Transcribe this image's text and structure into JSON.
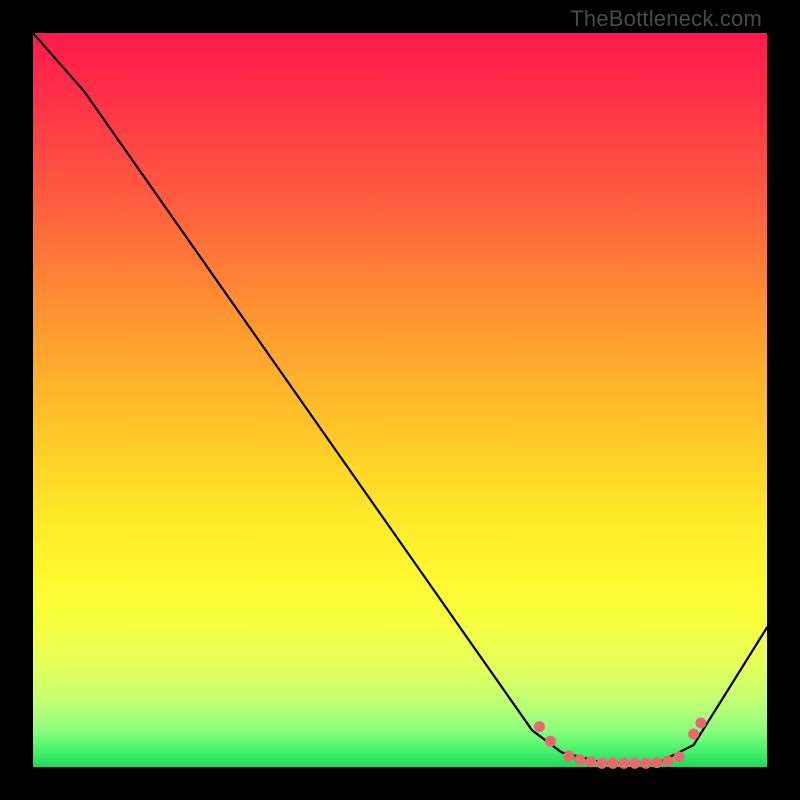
{
  "attribution": "TheBottleneck.com",
  "chart_data": {
    "type": "line",
    "title": "",
    "xlabel": "",
    "ylabel": "",
    "ylim": [
      0,
      100
    ],
    "background_gradient": {
      "top": "#ff1a4a",
      "upper_mid": "#ff8c33",
      "mid": "#ffe92a",
      "lower_mid": "#c2ff74",
      "bottom": "#1fd85a"
    },
    "curve": [
      {
        "x": 0,
        "y": 100
      },
      {
        "x": 7,
        "y": 92
      },
      {
        "x": 68,
        "y": 5
      },
      {
        "x": 72,
        "y": 2
      },
      {
        "x": 78,
        "y": 0.5
      },
      {
        "x": 85,
        "y": 0.5
      },
      {
        "x": 90,
        "y": 3
      },
      {
        "x": 100,
        "y": 19
      }
    ],
    "marked_points": [
      {
        "x": 69,
        "y": 5.5
      },
      {
        "x": 70.5,
        "y": 3.5
      },
      {
        "x": 73,
        "y": 1.5
      },
      {
        "x": 74.5,
        "y": 1.0
      },
      {
        "x": 76,
        "y": 0.7
      },
      {
        "x": 77.5,
        "y": 0.5
      },
      {
        "x": 79,
        "y": 0.5
      },
      {
        "x": 80.5,
        "y": 0.5
      },
      {
        "x": 82,
        "y": 0.5
      },
      {
        "x": 83.5,
        "y": 0.5
      },
      {
        "x": 85,
        "y": 0.6
      },
      {
        "x": 86.5,
        "y": 0.8
      },
      {
        "x": 88,
        "y": 1.4
      },
      {
        "x": 90,
        "y": 4.5
      },
      {
        "x": 91,
        "y": 6.0
      }
    ],
    "marker_color": "#e86a6a"
  }
}
